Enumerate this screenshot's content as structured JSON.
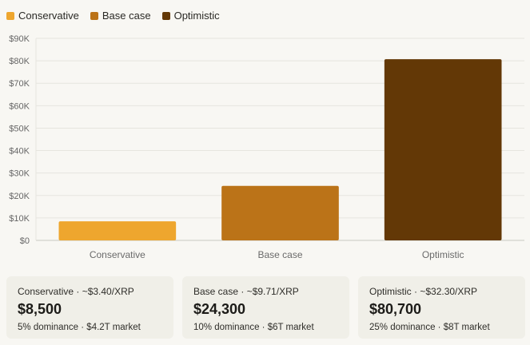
{
  "legend": [
    {
      "label": "Conservative",
      "color": "#eea62e"
    },
    {
      "label": "Base case",
      "color": "#bb7318"
    },
    {
      "label": "Optimistic",
      "color": "#633806"
    }
  ],
  "chart_data": {
    "type": "bar",
    "categories": [
      "Conservative",
      "Base case",
      "Optimistic"
    ],
    "values": [
      8500,
      24300,
      80700
    ],
    "colors": [
      "#eea62e",
      "#bb7318",
      "#633806"
    ],
    "ylim": [
      0,
      90000
    ],
    "yticks": [
      0,
      10000,
      20000,
      30000,
      40000,
      50000,
      60000,
      70000,
      80000,
      90000
    ],
    "ytick_labels": [
      "$0",
      "$10K",
      "$20K",
      "$30K",
      "$40K",
      "$50K",
      "$60K",
      "$70K",
      "$80K",
      "$90K"
    ],
    "grid": true,
    "legend_position": "top-left"
  },
  "cards": [
    {
      "title": "Conservative · ~$3.40/XRP",
      "value": "$8,500",
      "sub": "5% dominance · $4.2T market"
    },
    {
      "title": "Base case · ~$9.71/XRP",
      "value": "$24,300",
      "sub": "10% dominance · $6T market"
    },
    {
      "title": "Optimistic · ~$32.30/XRP",
      "value": "$80,700",
      "sub": "25% dominance · $8T market"
    }
  ]
}
